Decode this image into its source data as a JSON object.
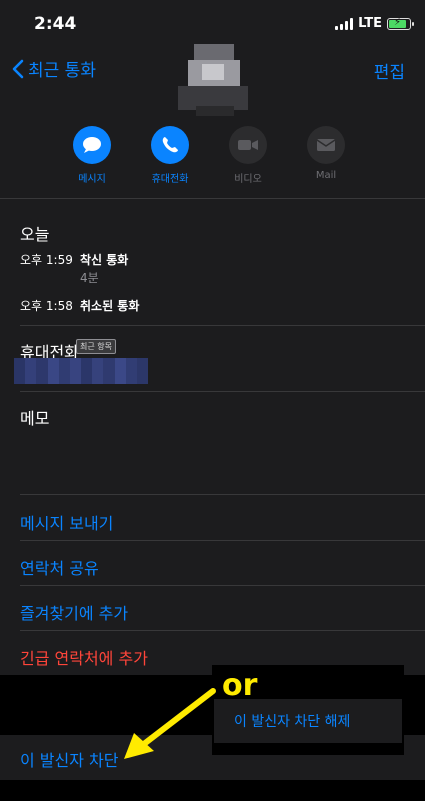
{
  "status_bar": {
    "time": "2:44",
    "network": "LTE"
  },
  "nav": {
    "back_label": "최근 통화",
    "edit_label": "편집"
  },
  "actions": [
    {
      "label": "메시지",
      "icon": "message-icon",
      "enabled": true
    },
    {
      "label": "휴대전화",
      "icon": "phone-icon",
      "enabled": true
    },
    {
      "label": "비디오",
      "icon": "video-icon",
      "enabled": false
    },
    {
      "label": "Mail",
      "icon": "mail-icon",
      "enabled": false
    }
  ],
  "calls": {
    "title": "오늘",
    "entries": [
      {
        "time": "오후 1:59",
        "type": "착신 통화",
        "duration": "4분"
      },
      {
        "time": "오후 1:58",
        "type": "취소된 통화",
        "duration": ""
      }
    ]
  },
  "phone": {
    "label": "휴대전화",
    "badge": "최근 항목"
  },
  "memo": {
    "label": "메모"
  },
  "links": {
    "send_message": "메시지 보내기",
    "share_contact": "연락처 공유",
    "add_favorites": "즐겨찾기에 추가",
    "add_emergency": "긴급 연락처에 추가"
  },
  "block": {
    "label": "이 발신자 차단",
    "unblock_label": "이 발신자 차단 해제"
  },
  "annotation": {
    "or_text": "or"
  },
  "colors": {
    "accent": "#0a84ff",
    "danger": "#ff453a",
    "highlight": "#ffeb00",
    "background": "#1c1c1e"
  }
}
